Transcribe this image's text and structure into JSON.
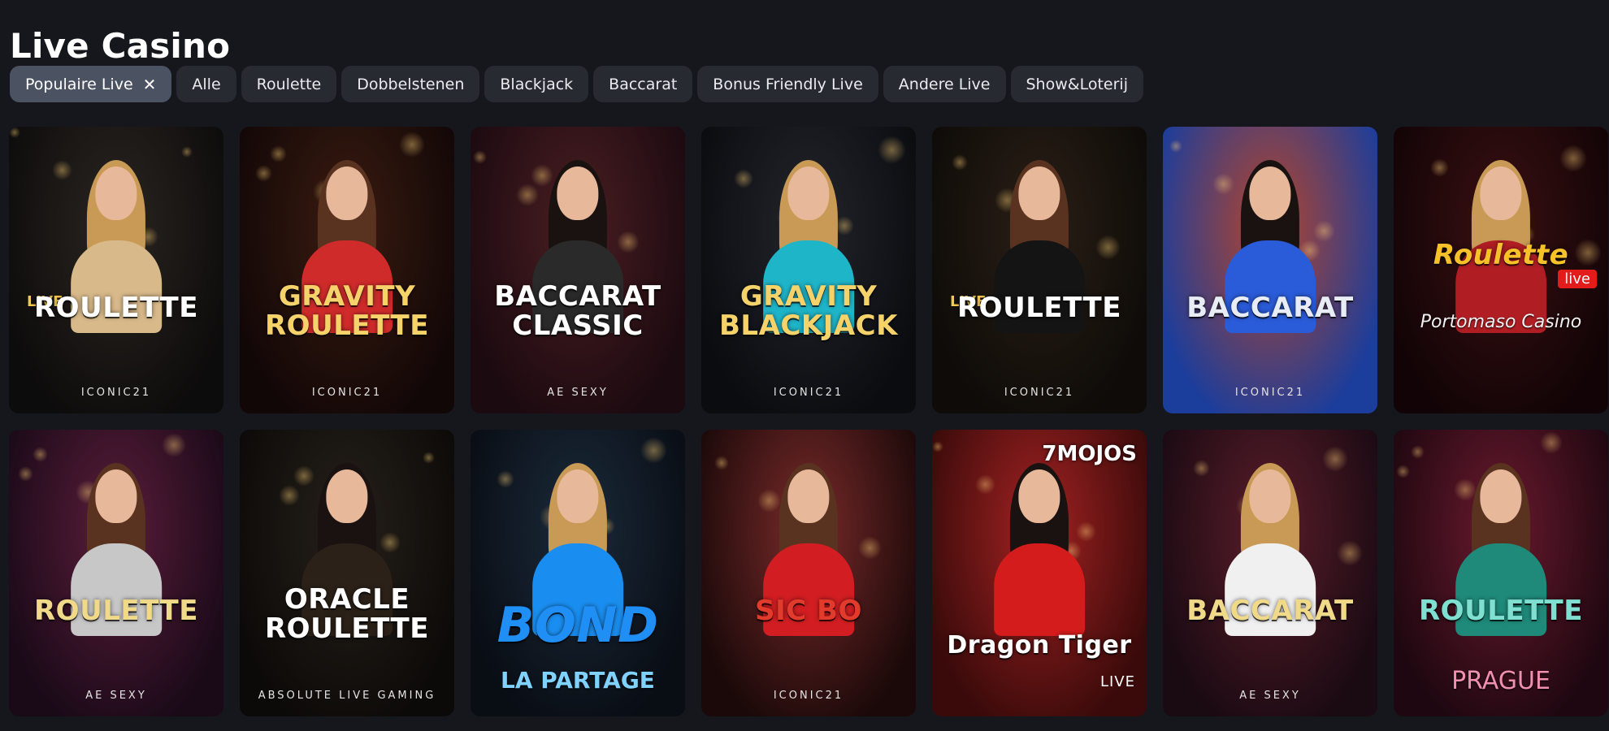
{
  "page": {
    "title": "Live Casino"
  },
  "filters": [
    {
      "label": "Populaire Live",
      "active": true
    },
    {
      "label": "Alle"
    },
    {
      "label": "Roulette"
    },
    {
      "label": "Dobbelstenen"
    },
    {
      "label": "Blackjack"
    },
    {
      "label": "Baccarat"
    },
    {
      "label": "Bonus Friendly Live"
    },
    {
      "label": "Andere Live"
    },
    {
      "label": "Show&Loterij"
    }
  ],
  "icons": {
    "clear_filter": "close-icon"
  },
  "games": [
    {
      "tag": "LIVE",
      "title": "ROULETTE",
      "provider": "ICONIC21",
      "bg1": "#2b2520",
      "bg2": "#0d0c0c",
      "accent": "#d8b98a",
      "titleColor": "#ffffff"
    },
    {
      "tag": "",
      "title": "GRAVITY\nROULETTE",
      "provider": "ICONIC21",
      "bg1": "#3a1c10",
      "bg2": "#120707",
      "accent": "#d02b2b",
      "titleColor": "#f6d36a"
    },
    {
      "tag": "",
      "title": "BACCARAT\nCLASSIC",
      "provider": "AE SEXY",
      "bg1": "#4a1e22",
      "bg2": "#1b0a10",
      "accent": "#2a2a2a",
      "titleColor": "#ffffff"
    },
    {
      "tag": "",
      "title": "GRAVITY\nBLACKJACK",
      "provider": "ICONIC21",
      "bg1": "#23252c",
      "bg2": "#0b0c10",
      "accent": "#1fb5c9",
      "titleColor": "#f6d36a"
    },
    {
      "tag": "LIVE",
      "title": "ROULETTE",
      "provider": "ICONIC21",
      "bg1": "#2a1f16",
      "bg2": "#0e0b08",
      "accent": "#141414",
      "titleColor": "#ffffff"
    },
    {
      "tag": "",
      "title": "BACCARAT",
      "provider": "ICONIC21",
      "bg1": "#b5452a",
      "bg2": "#1b3d9c",
      "accent": "#2a5bd8",
      "titleColor": "#e8ecf5"
    },
    {
      "tag": "",
      "title": "Roulette",
      "badge": "live",
      "sub": "Portomaso Casino",
      "provider": "",
      "bg1": "#3a1012",
      "bg2": "#120406",
      "accent": "#b01e24",
      "titleColor": "#f7c12a"
    },
    {
      "tag": "",
      "title": "ROULETTE",
      "provider": "AE SEXY",
      "bg1": "#5a1d3a",
      "bg2": "#1a0a18",
      "accent": "#c7c7c7",
      "titleColor": "#f1d98a"
    },
    {
      "tag": "",
      "title": "ORACLE\nROULETTE",
      "provider": "ABSOLUTE LIVE GAMING",
      "bg1": "#26201a",
      "bg2": "#0c0a08",
      "accent": "#2b2118",
      "titleColor": "#ffffff"
    },
    {
      "tag": "",
      "title": "BOND",
      "sub": "LA PARTAGE",
      "provider": "",
      "bg1": "#1b2a3a",
      "bg2": "#090d14",
      "accent": "#1a8ef0",
      "titleColor": "#1f8ef5"
    },
    {
      "tag": "",
      "title": "SIC BO",
      "provider": "ICONIC21",
      "bg1": "#7a2a2a",
      "bg2": "#1b0909",
      "accent": "#d21e22",
      "titleColor": "#e33b2b"
    },
    {
      "tag": "",
      "title": "Dragon Tiger",
      "corner": "7MOJOS",
      "live": "LIVE",
      "provider": "",
      "bg1": "#a32222",
      "bg2": "#3a0a0a",
      "accent": "#d41c1c",
      "titleColor": "#ffffff"
    },
    {
      "tag": "",
      "title": "BACCARAT",
      "provider": "AE SEXY",
      "bg1": "#5a1d2a",
      "bg2": "#1a0a12",
      "accent": "#f0f0f0",
      "titleColor": "#f1d98a"
    },
    {
      "tag": "",
      "title": "ROULETTE",
      "sub": "PRAGUE",
      "provider": "",
      "bg1": "#6a1a2e",
      "bg2": "#1e0710",
      "accent": "#1f8a7a",
      "titleColor": "#7fe0d2"
    }
  ]
}
